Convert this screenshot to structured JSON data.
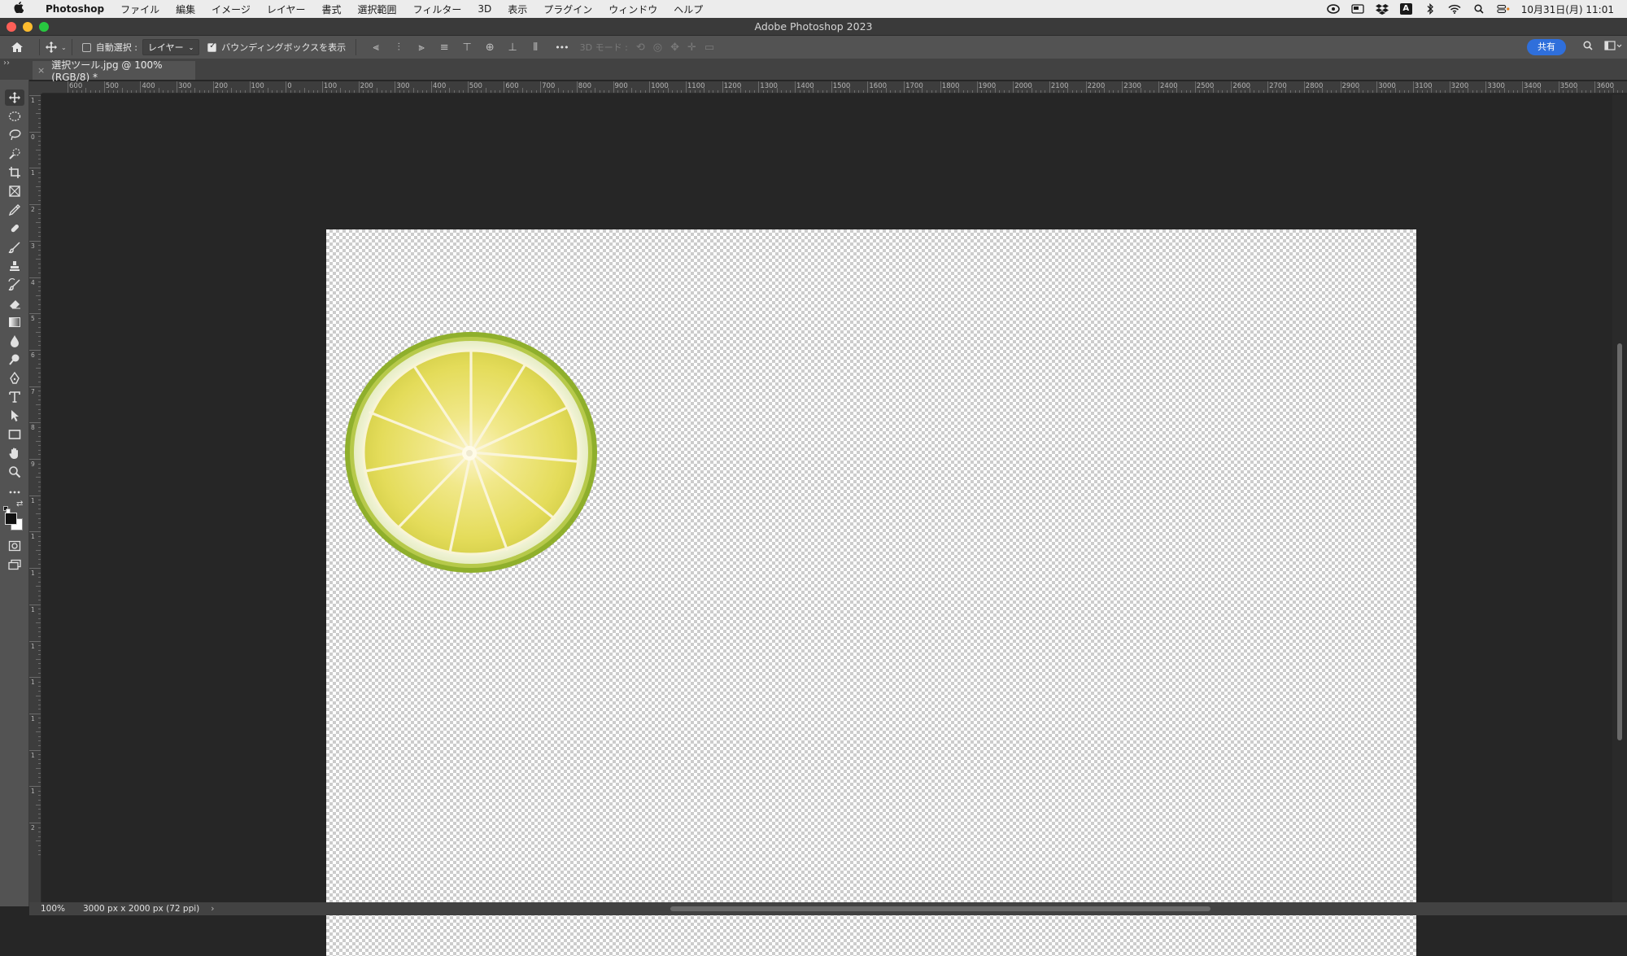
{
  "menubar": {
    "app_name": "Photoshop",
    "items": [
      "ファイル",
      "編集",
      "イメージ",
      "レイヤー",
      "書式",
      "選択範囲",
      "フィルター",
      "3D",
      "表示",
      "プラグイン",
      "ウィンドウ",
      "ヘルプ"
    ],
    "a_badge": "A",
    "clock": "10月31日(月)  11:01"
  },
  "window": {
    "title": "Adobe Photoshop 2023"
  },
  "options": {
    "auto_select_label": "自動選択 :",
    "auto_select_checked": false,
    "target_dropdown": "レイヤー",
    "bounding_box_label": "バウンディングボックスを表示",
    "bounding_box_checked": true,
    "more": "•••",
    "mode_3d_label": "3D モード :",
    "share_label": "共有"
  },
  "document_tab": {
    "close": "×",
    "title": "選択ツール.jpg @ 100% (RGB/8) *"
  },
  "panel_toggle": "››",
  "rulers": {
    "horizontal": [
      "600",
      "500",
      "400",
      "300",
      "200",
      "100",
      "0",
      "100",
      "200",
      "300",
      "400",
      "500",
      "600",
      "700",
      "800",
      "900",
      "1000",
      "1100",
      "1200",
      "1300",
      "1400",
      "1500",
      "1600",
      "1700",
      "1800",
      "1900",
      "2000",
      "2100",
      "2200",
      "2300",
      "2400",
      "2500",
      "2600",
      "2700",
      "2800",
      "2900",
      "3000",
      "3100",
      "3200",
      "3300",
      "3400",
      "3500",
      "3600"
    ],
    "vertical": [
      "1",
      "0",
      "1",
      "2",
      "3",
      "4",
      "5",
      "6",
      "7",
      "8",
      "9",
      "1",
      "1",
      "1",
      "1",
      "1",
      "1",
      "1",
      "1",
      "1",
      "2"
    ]
  },
  "status": {
    "zoom": "100%",
    "doc_info": "3000 px x 2000 px (72 ppi)",
    "arrow": "›"
  },
  "colors": {
    "accent_share": "#2f6fdb",
    "canvas_bg": "#262626"
  }
}
